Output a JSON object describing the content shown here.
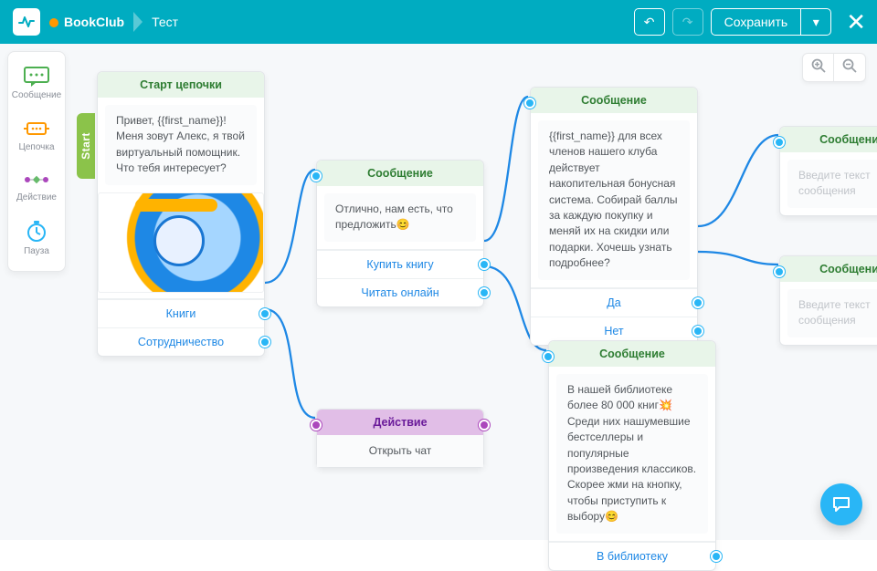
{
  "topbar": {
    "project": "BookClub",
    "page": "Тест",
    "undo_icon": "↶",
    "redo_icon": "↷",
    "save_label": "Сохранить",
    "save_chevron": "▾",
    "close_glyph": "✕"
  },
  "palette": {
    "message": "Сообщение",
    "chain": "Цепочка",
    "action": "Действие",
    "pause": "Пауза"
  },
  "start_tab": "Start",
  "zoom": {
    "in": "🔍",
    "out": "🔍"
  },
  "nodes": {
    "start": {
      "title": "Старт цепочки",
      "text": "Привет, {{first_name}}!\nМеня зовут Алекс, я твой виртуальный помощник. Что тебя интересует?",
      "options": [
        "Книги",
        "Сотрудничество"
      ]
    },
    "msg1": {
      "title": "Сообщение",
      "text": "Отлично, нам есть, что предложить😊",
      "options": [
        "Купить книгу",
        "Читать онлайн"
      ]
    },
    "action": {
      "title": "Действие",
      "text": "Открыть чат"
    },
    "msg2": {
      "title": "Сообщение",
      "text": "{{first_name}} для всех членов нашего клуба действует накопительная бонусная система. Собирай баллы за каждую покупку и меняй их на скидки или подарки. Хочешь узнать подробнее?",
      "options": [
        "Да",
        "Нет"
      ]
    },
    "msg3": {
      "title": "Сообщение",
      "text": "В нашей библиотеке более 80 000 книг💥 Среди них нашумевшие бестселлеры и популярные произведения классиков. Скорее жми на кнопку, чтобы приступить к выбору😊",
      "options": [
        "В библиотеку"
      ]
    },
    "msg4": {
      "title": "Сообщение",
      "placeholder": "Введите текст сообщения"
    },
    "msg5": {
      "title": "Сообщение",
      "placeholder": "Введите текст сообщения"
    }
  }
}
